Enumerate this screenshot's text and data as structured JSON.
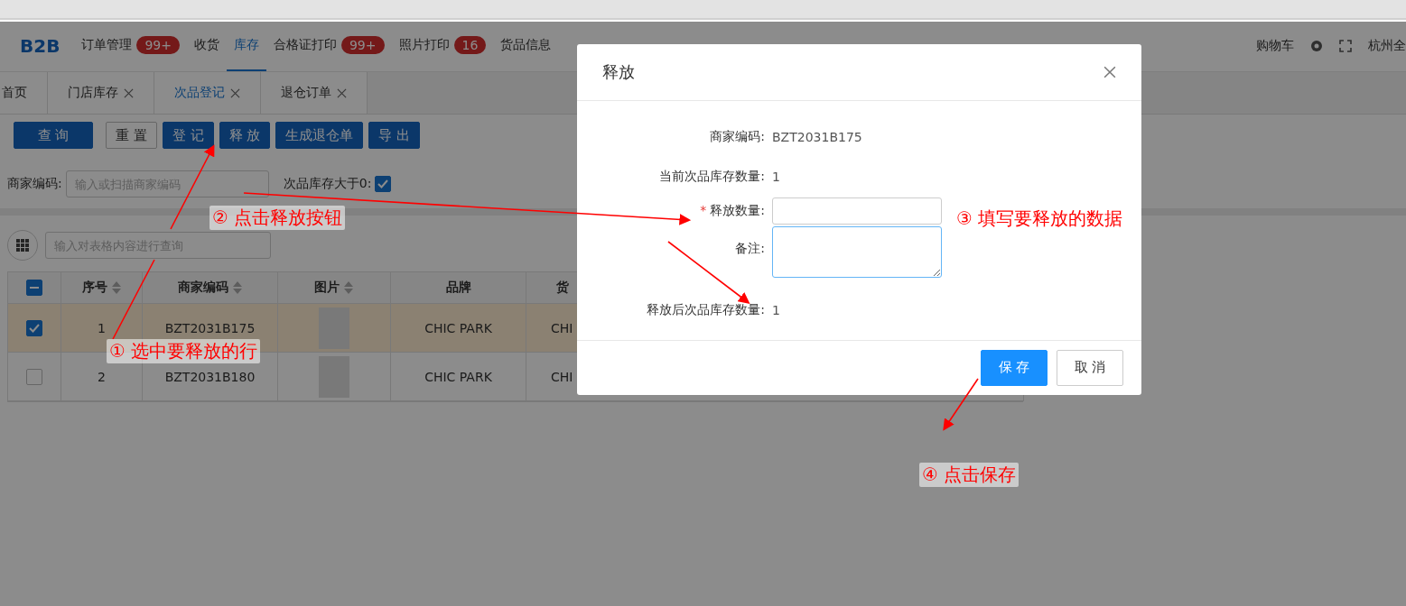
{
  "nav": {
    "logo": "B2B",
    "items": [
      {
        "label": "订单管理",
        "badge": "99+",
        "selected": false
      },
      {
        "label": "收货",
        "selected": false
      },
      {
        "label": "库存",
        "selected": true
      },
      {
        "label": "合格证打印",
        "badge": "99+",
        "selected": false
      },
      {
        "label": "照片打印",
        "badge": "16",
        "selected": false
      },
      {
        "label": "货品信息",
        "selected": false
      }
    ],
    "right": [
      "购物车",
      "杭州全"
    ]
  },
  "tabs": [
    {
      "label": "首页",
      "closable": false,
      "selected": false
    },
    {
      "label": "门店库存",
      "closable": true,
      "selected": false
    },
    {
      "label": "次品登记",
      "closable": true,
      "selected": true
    },
    {
      "label": "退仓订单",
      "closable": true,
      "selected": false
    }
  ],
  "toolbar": [
    "查 询",
    "重 置",
    "登 记",
    "释 放",
    "生成退仓单",
    "导 出"
  ],
  "filters": {
    "code_label": "商家编码:",
    "code_placeholder": "输入或扫描商家编码",
    "stock_label": "次品库存大于0:",
    "stock_checked": true
  },
  "table_search": {
    "placeholder": "输入对表格内容进行查询"
  },
  "table": {
    "columns": [
      "序号",
      "商家编码",
      "图片",
      "品牌",
      "货"
    ],
    "all_indeterminate": true,
    "rows": [
      {
        "selected": true,
        "cells": [
          "1",
          "BZT2031B175",
          "",
          "CHIC PARK",
          "CHI"
        ]
      },
      {
        "selected": false,
        "cells": [
          "2",
          "BZT2031B180",
          "",
          "CHIC PARK",
          "CHI"
        ]
      }
    ]
  },
  "dialog": {
    "title": "释放",
    "required_mark": "*",
    "fields": [
      {
        "kind": "text",
        "label": "商家编码:",
        "value": "BZT2031B175",
        "required": false
      },
      {
        "kind": "text",
        "label": "当前次品库存数量:",
        "value": "1",
        "required": false
      },
      {
        "kind": "input",
        "label": "释放数量:",
        "required": true
      },
      {
        "kind": "textarea",
        "label": "备注:",
        "required": false
      },
      {
        "kind": "text",
        "label": "释放后次品库存数量:",
        "value": "1",
        "required": false
      }
    ],
    "buttons": [
      {
        "label": "保 存",
        "primary": true
      },
      {
        "label": "取 消",
        "primary": false
      }
    ]
  },
  "annotations": [
    "① 选中要释放的行",
    "② 点击释放按钮",
    "③ 填写要释放的数据",
    "④ 点击保存"
  ]
}
